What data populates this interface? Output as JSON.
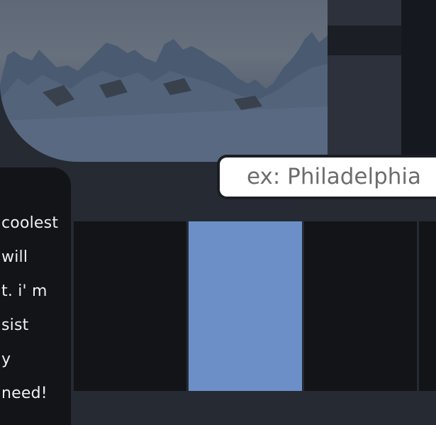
{
  "search": {
    "placeholder": "ex: Philadelphia"
  },
  "description": {
    "lines": [
      "coolest",
      "will",
      "t. i' m",
      "sist",
      "y",
      "need!"
    ]
  },
  "grid": {
    "cells": [
      {
        "active": false
      },
      {
        "active": true
      },
      {
        "active": false
      },
      {
        "active": false
      }
    ],
    "active_color": "#6b8fc6"
  }
}
